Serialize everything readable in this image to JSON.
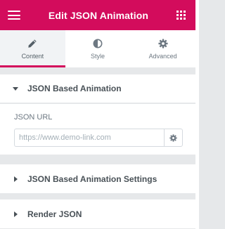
{
  "header": {
    "title": "Edit JSON Animation",
    "left_icon": "hamburger-icon",
    "right_icon": "grid-icon",
    "color": "#d30c5c"
  },
  "tabs": [
    {
      "label": "Content",
      "icon": "pencil-icon",
      "active": true
    },
    {
      "label": "Style",
      "icon": "contrast-icon",
      "active": false
    },
    {
      "label": "Advanced",
      "icon": "gear-icon",
      "active": false
    }
  ],
  "sections": {
    "json_based_animation": {
      "title": "JSON Based Animation",
      "expanded": true,
      "json_url": {
        "label": "JSON URL",
        "placeholder": "https://www.demo-link.com",
        "value": "",
        "action_icon": "gear-icon"
      }
    },
    "json_based_animation_settings": {
      "title": "JSON Based Animation Settings",
      "expanded": false
    },
    "render_json": {
      "title": "Render JSON",
      "expanded": false
    }
  }
}
